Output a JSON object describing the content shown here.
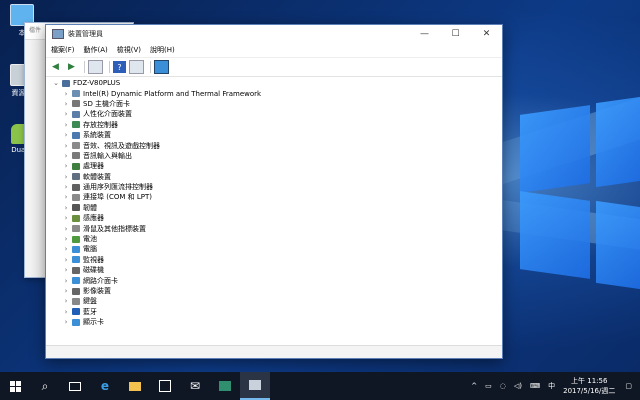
{
  "desktop": {
    "icons": [
      {
        "label": "本",
        "icon": "computer-icon"
      },
      {
        "label": "資源回",
        "icon": "recycle-bin-icon"
      },
      {
        "label": "DualO",
        "icon": "android-icon"
      }
    ]
  },
  "back_window": {
    "title": "檔件"
  },
  "window": {
    "title": "裝置管理員",
    "controls": {
      "minimize": "—",
      "maximize": "☐",
      "close": "✕"
    },
    "menu": [
      "檔案(F)",
      "動作(A)",
      "檢視(V)",
      "說明(H)"
    ],
    "toolbar_icons": [
      "back-arrow-icon",
      "forward-arrow-icon",
      "properties-icon",
      "help-icon",
      "device-view-icon",
      "monitor-icon"
    ],
    "tree": {
      "root": "FDZ-V80PLUS",
      "items": [
        {
          "label": "Intel(R) Dynamic Platform and Thermal Framework",
          "color": "#6a8fb3"
        },
        {
          "label": "SD 主機介面卡",
          "color": "#777777"
        },
        {
          "label": "人性化介面裝置",
          "color": "#5a7ea8"
        },
        {
          "label": "存放控制器",
          "color": "#3d8a55"
        },
        {
          "label": "系統裝置",
          "color": "#4c79b0"
        },
        {
          "label": "音效、視訊及遊戲控制器",
          "color": "#8a8a8a"
        },
        {
          "label": "音訊輸入與輸出",
          "color": "#7a7a7a"
        },
        {
          "label": "處理器",
          "color": "#3f7f3f"
        },
        {
          "label": "軟體裝置",
          "color": "#5f6f80"
        },
        {
          "label": "通用序列匯流排控制器",
          "color": "#606060"
        },
        {
          "label": "連接埠 (COM 和 LPT)",
          "color": "#8a8a8a"
        },
        {
          "label": "韌體",
          "color": "#555555"
        },
        {
          "label": "感應器",
          "color": "#6a8f3f"
        },
        {
          "label": "滑鼠及其他指標裝置",
          "color": "#8a8a8a"
        },
        {
          "label": "電池",
          "color": "#4f9a3f"
        },
        {
          "label": "電腦",
          "color": "#3b8fd6"
        },
        {
          "label": "監視器",
          "color": "#3b8fd6"
        },
        {
          "label": "磁碟機",
          "color": "#666666"
        },
        {
          "label": "網路介面卡",
          "color": "#3b8fd6"
        },
        {
          "label": "影像裝置",
          "color": "#666666"
        },
        {
          "label": "鍵盤",
          "color": "#888888"
        },
        {
          "label": "藍牙",
          "color": "#1f5fb8"
        },
        {
          "label": "顯示卡",
          "color": "#3b8fd6"
        }
      ]
    }
  },
  "taskbar": {
    "items": [
      "start-icon",
      "search-icon",
      "task-view-icon",
      "edge-icon",
      "file-explorer-icon",
      "store-icon",
      "mail-icon",
      "app-icon",
      "device-manager-icon"
    ],
    "tray": {
      "ime": "中",
      "time": "上午 11:56",
      "date": "2017/5/16/週二"
    }
  }
}
